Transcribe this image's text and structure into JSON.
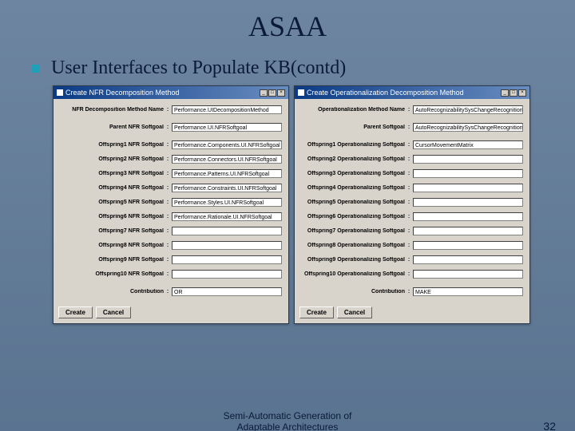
{
  "title": "ASAA",
  "bullet": "User Interfaces to Populate KB(contd)",
  "dialog1": {
    "titlebar": "Create NFR Decomposition Method",
    "rows": [
      {
        "label": "NFR Decomposition Method Name",
        "value": "Performance.UIDecompositionMethod"
      },
      {
        "label": "Parent NFR Softgoal",
        "value": "Performance.UI.NFRSoftgoal"
      },
      {
        "label": "Offspring1 NFR Softgoal",
        "value": "Performance.Components.UI.NFRSoftgoal"
      },
      {
        "label": "Offspring2 NFR Softgoal",
        "value": "Performance.Connectors.UI.NFRSoftgoal"
      },
      {
        "label": "Offspring3 NFR Softgoal",
        "value": "Performance.Patterns.UI.NFRSoftgoal"
      },
      {
        "label": "Offspring4 NFR Softgoal",
        "value": "Performance.Constraints.UI.NFRSoftgoal"
      },
      {
        "label": "Offspring5 NFR Softgoal",
        "value": "Performance.Styles.UI.NFRSoftgoal"
      },
      {
        "label": "Offspring6 NFR Softgoal",
        "value": "Performance.Rationale.UI.NFRSoftgoal"
      },
      {
        "label": "Offspring7 NFR Softgoal",
        "value": ""
      },
      {
        "label": "Offspring8 NFR Softgoal",
        "value": ""
      },
      {
        "label": "Offspring9 NFR Softgoal",
        "value": ""
      },
      {
        "label": "Offspring10 NFR Softgoal",
        "value": ""
      },
      {
        "label": "Contribution",
        "value": "OR"
      }
    ],
    "buttons": {
      "create": "Create",
      "cancel": "Cancel"
    }
  },
  "dialog2": {
    "titlebar": "Create Operationalization Decomposition Method",
    "rows": [
      {
        "label": "Operationalization Method Name",
        "value": "AutoRecognizabilitySysChangeRecognitionReaso"
      },
      {
        "label": "Parent Softgoal",
        "value": "AutoRecognizabilitySysChangeRecognitionReaso"
      },
      {
        "label": "Offspring1 Operationalizing Softgoal",
        "value": "CursorMovementMatrix"
      },
      {
        "label": "Offspring2 Operationalizing Softgoal",
        "value": ""
      },
      {
        "label": "Offspring3 Operationalizing Softgoal",
        "value": ""
      },
      {
        "label": "Offspring4 Operationalizing Softgoal",
        "value": ""
      },
      {
        "label": "Offspring5 Operationalizing Softgoal",
        "value": ""
      },
      {
        "label": "Offspring6 Operationalizing Softgoal",
        "value": ""
      },
      {
        "label": "Offspring7 Operationalizing Softgoal",
        "value": ""
      },
      {
        "label": "Offspring8 Operationalizing Softgoal",
        "value": ""
      },
      {
        "label": "Offspring9 Operationalizing Softgoal",
        "value": ""
      },
      {
        "label": "Offspring10 Operationalizing Softgoal",
        "value": ""
      },
      {
        "label": "Contribution",
        "value": "MAKE"
      }
    ],
    "buttons": {
      "create": "Create",
      "cancel": "Cancel"
    }
  },
  "footer_line1": "Semi-Automatic Generation of",
  "footer_line2": "Adaptable Architectures",
  "page": "32"
}
